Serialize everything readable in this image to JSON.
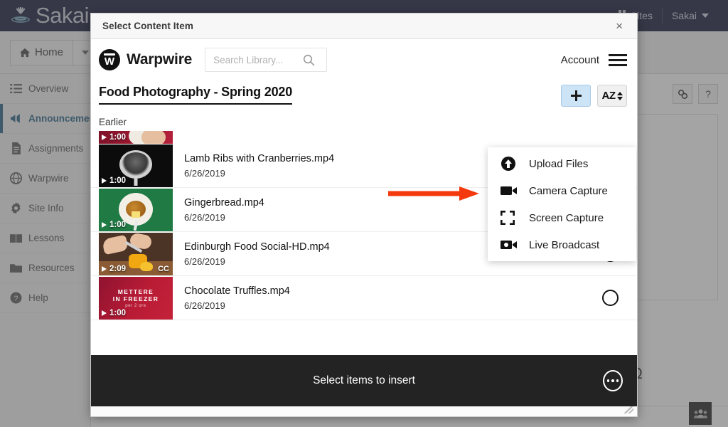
{
  "sakai": {
    "brand": "Sakai",
    "top_right": [
      {
        "label": "Sites",
        "icon": "grid-icon"
      },
      {
        "label": "Sakai",
        "icon": "chevron-down-icon"
      }
    ],
    "home_button": "Home",
    "sidebar_items": [
      {
        "label": "Overview",
        "icon": "list-icon",
        "active": false
      },
      {
        "label": "Announcements",
        "icon": "megaphone-icon",
        "active": true
      },
      {
        "label": "Assignments",
        "icon": "document-icon",
        "active": false
      },
      {
        "label": "Warpwire",
        "icon": "globe-icon",
        "active": false
      },
      {
        "label": "Site Info",
        "icon": "gear-icon",
        "active": false
      },
      {
        "label": "Lessons",
        "icon": "book-icon",
        "active": false
      },
      {
        "label": "Resources",
        "icon": "folder-icon",
        "active": false
      },
      {
        "label": "Help",
        "icon": "question-circle-icon",
        "active": false
      }
    ],
    "tool_buttons": [
      {
        "label": "",
        "icon": "link-icon"
      },
      {
        "label": "?",
        "icon": "help-icon"
      }
    ],
    "omega_symbol": "Ω",
    "people_icon": "people-icon"
  },
  "dialog": {
    "title": "Select Content Item",
    "close_label": "×"
  },
  "warpwire": {
    "brand": "Warpwire",
    "logo_letter": "W",
    "search": {
      "value": "",
      "placeholder": "Search Library...",
      "icon": "search-icon"
    },
    "account_label": "Account",
    "menu_icon": "hamburger-icon"
  },
  "library": {
    "title": "Food Photography - Spring 2020",
    "section_label": "Earlier",
    "add_button_icon": "plus-icon",
    "sort_button_label": "AZ",
    "sort_button_icon": "sort-az-icon"
  },
  "add_menu": {
    "items": [
      {
        "label": "Upload Files",
        "icon": "upload-circle-icon"
      },
      {
        "label": "Camera Capture",
        "icon": "video-camera-icon"
      },
      {
        "label": "Screen Capture",
        "icon": "crop-brackets-icon"
      },
      {
        "label": "Live Broadcast",
        "icon": "live-broadcast-icon"
      }
    ]
  },
  "videos": [
    {
      "name": "",
      "date": "",
      "duration": "1:00",
      "cc": false,
      "thumb": "dark-red-cup",
      "clipped": true
    },
    {
      "name": "Lamb Ribs with Cranberries.mp4",
      "date": "6/26/2019",
      "duration": "1:00",
      "cc": false,
      "thumb": "black-pan",
      "clipped": false
    },
    {
      "name": "Gingerbread.mp4",
      "date": "6/26/2019",
      "duration": "1:00",
      "cc": false,
      "thumb": "green-bowl",
      "clipped": false
    },
    {
      "name": "Edinburgh Food Social-HD.mp4",
      "date": "6/26/2019",
      "duration": "2:09",
      "cc": true,
      "cc_label": "CC",
      "thumb": "food-cutting",
      "clipped": false
    },
    {
      "name": "Chocolate Truffles.mp4",
      "date": "6/26/2019",
      "duration": "1:00",
      "cc": false,
      "thumb": "red-title",
      "thumb_text": {
        "line1": "METTERE",
        "line2": "IN FREEZER",
        "line3": "per 2 ore"
      },
      "clipped": false
    }
  ],
  "footer": {
    "text": "Select items to insert",
    "more_icon": "ellipsis-circle-icon"
  },
  "annotation": {
    "arrow_color": "#f5390e",
    "points_at": "Camera Capture"
  }
}
